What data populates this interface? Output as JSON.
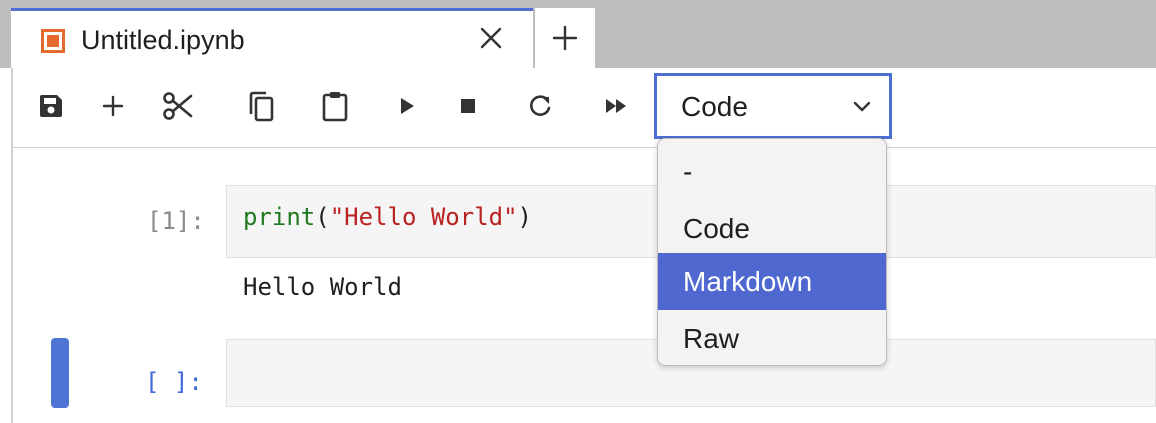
{
  "tab": {
    "title": "Untitled.ipynb",
    "icon": "notebook-icon",
    "close_icon": "close-icon",
    "add_icon": "plus-icon",
    "accent": "#4e6ed3",
    "icon_color": "#e46a2e"
  },
  "toolbar": {
    "buttons": [
      {
        "name": "save-icon"
      },
      {
        "name": "add-cell-icon"
      },
      {
        "name": "cut-icon"
      },
      {
        "name": "copy-icon"
      },
      {
        "name": "paste-icon"
      },
      {
        "name": "run-icon"
      },
      {
        "name": "stop-icon"
      },
      {
        "name": "restart-icon"
      },
      {
        "name": "run-all-icon"
      }
    ],
    "cell_type_select": {
      "value": "Code",
      "options": [
        "-",
        "Code",
        "Markdown",
        "Raw"
      ],
      "highlighted": "Markdown"
    }
  },
  "cells": [
    {
      "prompt": "[1]:",
      "code": {
        "fn": "print",
        "open": "(",
        "arg": "\"Hello World\"",
        "close": ")"
      },
      "output": "Hello World"
    },
    {
      "prompt": "[ ]:",
      "code": ""
    }
  ],
  "colors": {
    "selected_option_bg": "#4e68d0",
    "active_marker": "#4e76d4",
    "keyword": "#1f7a1f",
    "string": "#ba2121"
  }
}
